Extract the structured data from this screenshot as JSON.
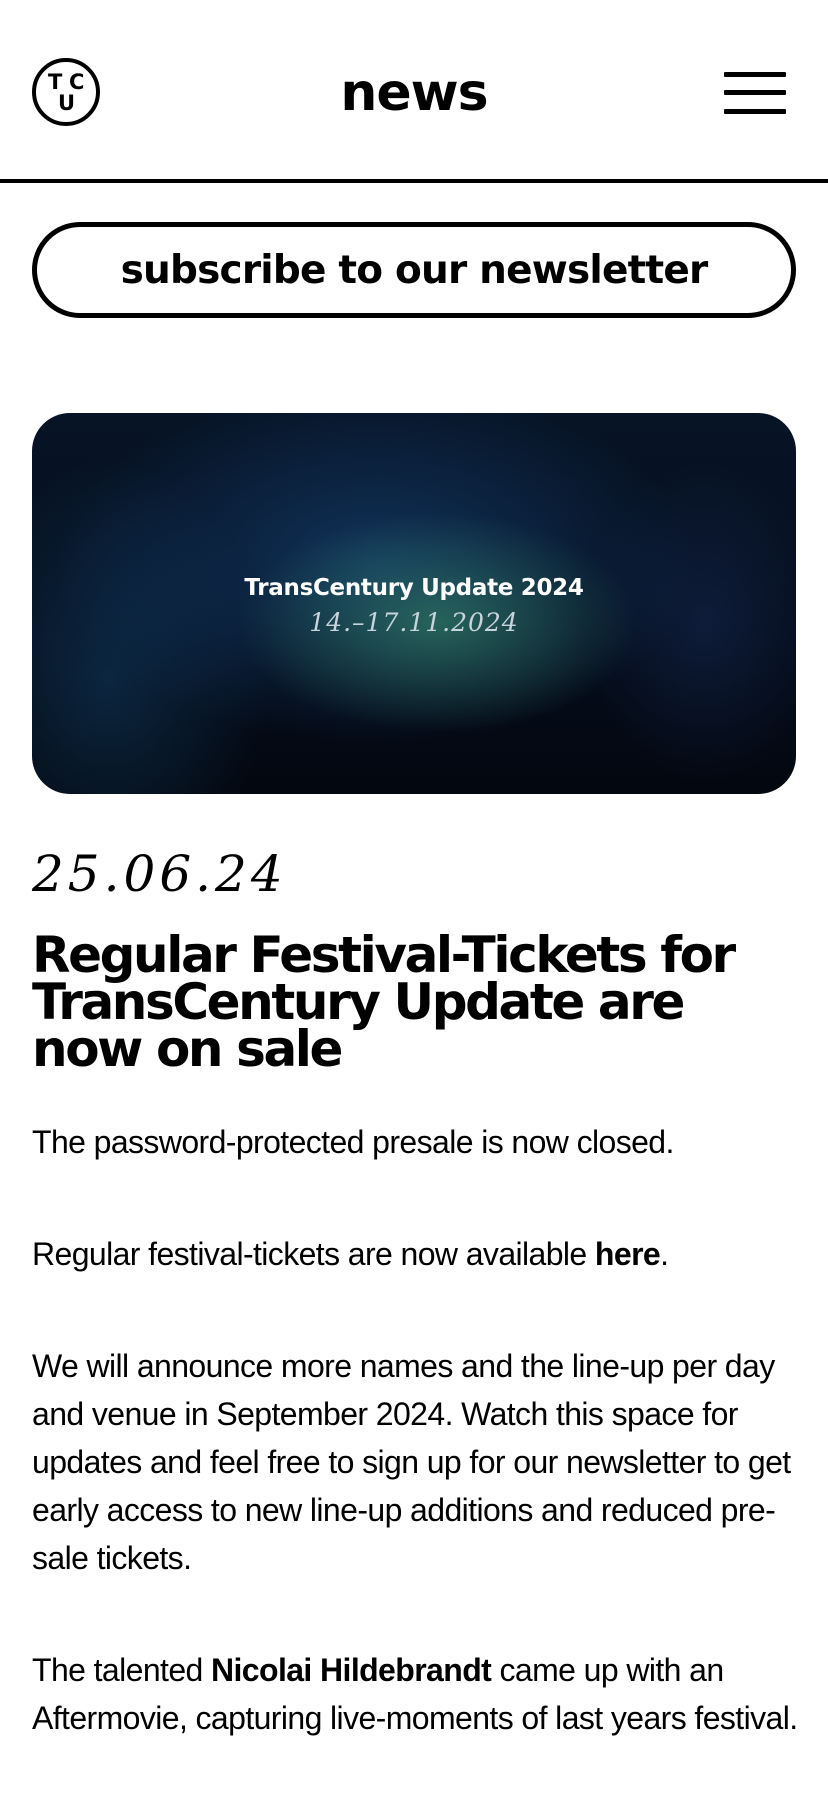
{
  "header": {
    "logo": {
      "l1": "T",
      "l2": "C",
      "l3": "U"
    },
    "title": "news",
    "menu_icon": "hamburger-menu-icon"
  },
  "subscribe": {
    "label": "subscribe to our newsletter"
  },
  "hero": {
    "title": "TransCentury Update 2024",
    "dates": "14.–17.11.2024"
  },
  "article": {
    "date": "25.06.24",
    "headline": "Regular Festival-Tickets for TransCentury Update are now on sale",
    "p1": "The password-protected presale is now closed.",
    "p2_before": "Regular festival-tickets are now available ",
    "p2_link": "here",
    "p2_after": ".",
    "p3": "We will announce more names and the line-up per day and venue in September 2024. Watch this space for updates and feel free to sign up for our newsletter to get early access to new line-up additions and reduced pre-sale tickets.",
    "p4_before": "The talented ",
    "p4_name": "Nicolai Hildebrandt",
    "p4_after": " came up with an Aftermovie, capturing live-moments of last years festival."
  }
}
